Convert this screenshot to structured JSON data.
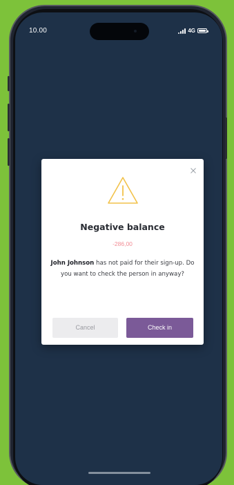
{
  "status_bar": {
    "time": "10.00",
    "network": "4G"
  },
  "dialog": {
    "title": "Negative balance",
    "amount": "-286,00",
    "message": {
      "name": "John Johnson",
      "text": " has not paid for their sign-up. Do you want to check the person in anyway?"
    },
    "cancel_label": "Cancel",
    "confirm_label": "Check in"
  },
  "colors": {
    "background": "#7dc23a",
    "screen": "#1e3148",
    "warning": "#f2c24a",
    "amount": "#f28d95",
    "primary_button": "#7b5a98",
    "secondary_button": "#ececee"
  },
  "icons": {
    "warning": "warning-icon",
    "close": "close-icon",
    "signal": "signal-icon",
    "battery": "battery-icon"
  }
}
